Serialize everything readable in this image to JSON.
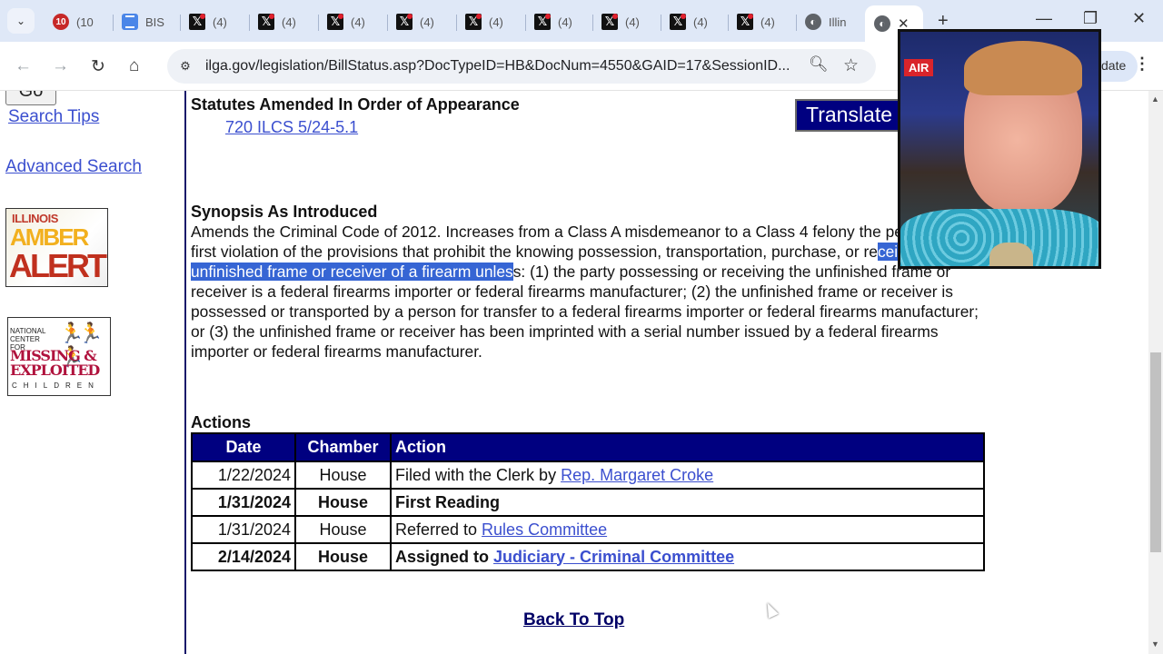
{
  "browser": {
    "tabs": [
      {
        "icon": "calendar-badge-icon",
        "badge": "10",
        "label": "(10"
      },
      {
        "icon": "docs-icon",
        "label": "BIS"
      },
      {
        "icon": "x-logo-icon",
        "label": "(4)"
      },
      {
        "icon": "x-logo-icon",
        "label": "(4)"
      },
      {
        "icon": "x-logo-icon",
        "label": "(4)"
      },
      {
        "icon": "x-logo-icon",
        "label": "(4)"
      },
      {
        "icon": "x-logo-icon",
        "label": "(4)"
      },
      {
        "icon": "x-logo-icon",
        "label": "(4)"
      },
      {
        "icon": "x-logo-icon",
        "label": "(4)"
      },
      {
        "icon": "x-logo-icon",
        "label": "(4)"
      },
      {
        "icon": "x-logo-icon",
        "label": "(4)"
      },
      {
        "icon": "globe-icon",
        "label": "Illin"
      }
    ],
    "active_tab": {
      "icon": "globe-icon",
      "close": "✕"
    },
    "new_tab": "+",
    "window_controls": {
      "minimize": "—",
      "restore": "❐",
      "close": "✕"
    },
    "url": "ilga.gov/legislation/BillStatus.asp?DocTypeID=HB&DocNum=4550&GAID=17&SessionID...",
    "update_label": "date",
    "nav": {
      "back": "←",
      "forward": "→",
      "reload": "↻",
      "home": "⌂"
    }
  },
  "sidebar": {
    "go_button": "Go",
    "search_tips": "Search Tips",
    "advanced_search": "Advanced Search",
    "amber_alert": {
      "line1": "ILLINOIS",
      "line2": "AMBER",
      "line3": "ALERT"
    },
    "ncmec": {
      "line1": "NATIONAL CENTER FOR",
      "line2": "MISSING &",
      "line3": "EXPLOITED",
      "line4": "CHILDREN"
    }
  },
  "content": {
    "statutes_heading": "Statutes Amended In Order of Appearance",
    "statute_link": "720 ILCS 5/24-5.1",
    "translate_button": "Translate",
    "synopsis_heading": "Synopsis As Introduced",
    "synopsis_before": "Amends the Criminal Code of 2012. Increases from a Class A misdemeanor to a Class 4 felony the penalty for a first violation of the provisions that prohibit the knowing possession, transportation, purchase, or re",
    "synopsis_selected": "ceipt of an unfinished frame or receiver of a firearm unles",
    "synopsis_after": "s: (1) the party possessing or receiving the unfinished frame or receiver is a federal firearms importer or federal firearms manufacturer; (2) the unfinished frame or receiver is possessed or transported by a person for transfer to a federal firearms importer or federal firearms manufacturer; or (3) the unfinished frame or receiver has been imprinted with a serial number issued by a federal firearms importer or federal firearms manufacturer.",
    "actions_heading": "Actions",
    "actions_table": {
      "headers": [
        "Date",
        "Chamber",
        "Action"
      ],
      "rows": [
        {
          "date": "1/22/2024",
          "chamber": "House",
          "action_text": "Filed with the Clerk by ",
          "action_link": "Rep. Margaret Croke",
          "bold": false
        },
        {
          "date": "1/31/2024",
          "chamber": "House",
          "action_text": "First Reading",
          "action_link": "",
          "bold": true
        },
        {
          "date": "1/31/2024",
          "chamber": "House",
          "action_text": "Referred to ",
          "action_link": "Rules Committee",
          "bold": false
        },
        {
          "date": "2/14/2024",
          "chamber": "House",
          "action_text": "Assigned to ",
          "action_link": "Judiciary - Criminal Committee",
          "bold": true
        }
      ]
    },
    "back_to_top": "Back To Top"
  },
  "overlay": {
    "webcam_badge": "AIR"
  },
  "colors": {
    "header_navy": "#000080",
    "link": "#3b4fcf",
    "selection": "#3665d4"
  }
}
